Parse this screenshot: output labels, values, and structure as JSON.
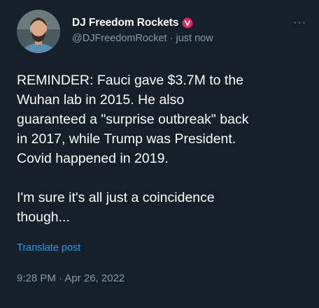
{
  "post": {
    "author": {
      "display_name": "DJ Freedom Rockets",
      "handle": "@DJFreedomRocket",
      "separator": "·",
      "time_ago": "just now",
      "verified_icon": "verified-badge-icon",
      "verified_color": "#e0245e"
    },
    "more_label": "···",
    "text": "REMINDER: Fauci gave $3.7M to the\nWuhan lab in 2015. He also\nguaranteed a \"surprise outbreak\" back\nin 2017, while Trump was President.\nCovid happened in 2019.\n\nI'm sure it's all just a coincidence\nthough...",
    "translate_label": "Translate post",
    "timestamp": "9:28 PM · Apr 26, 2022"
  },
  "colors": {
    "background": "#15202b",
    "text_primary": "#ffffff",
    "text_secondary": "#8b98a5",
    "link": "#1d9bf0"
  }
}
